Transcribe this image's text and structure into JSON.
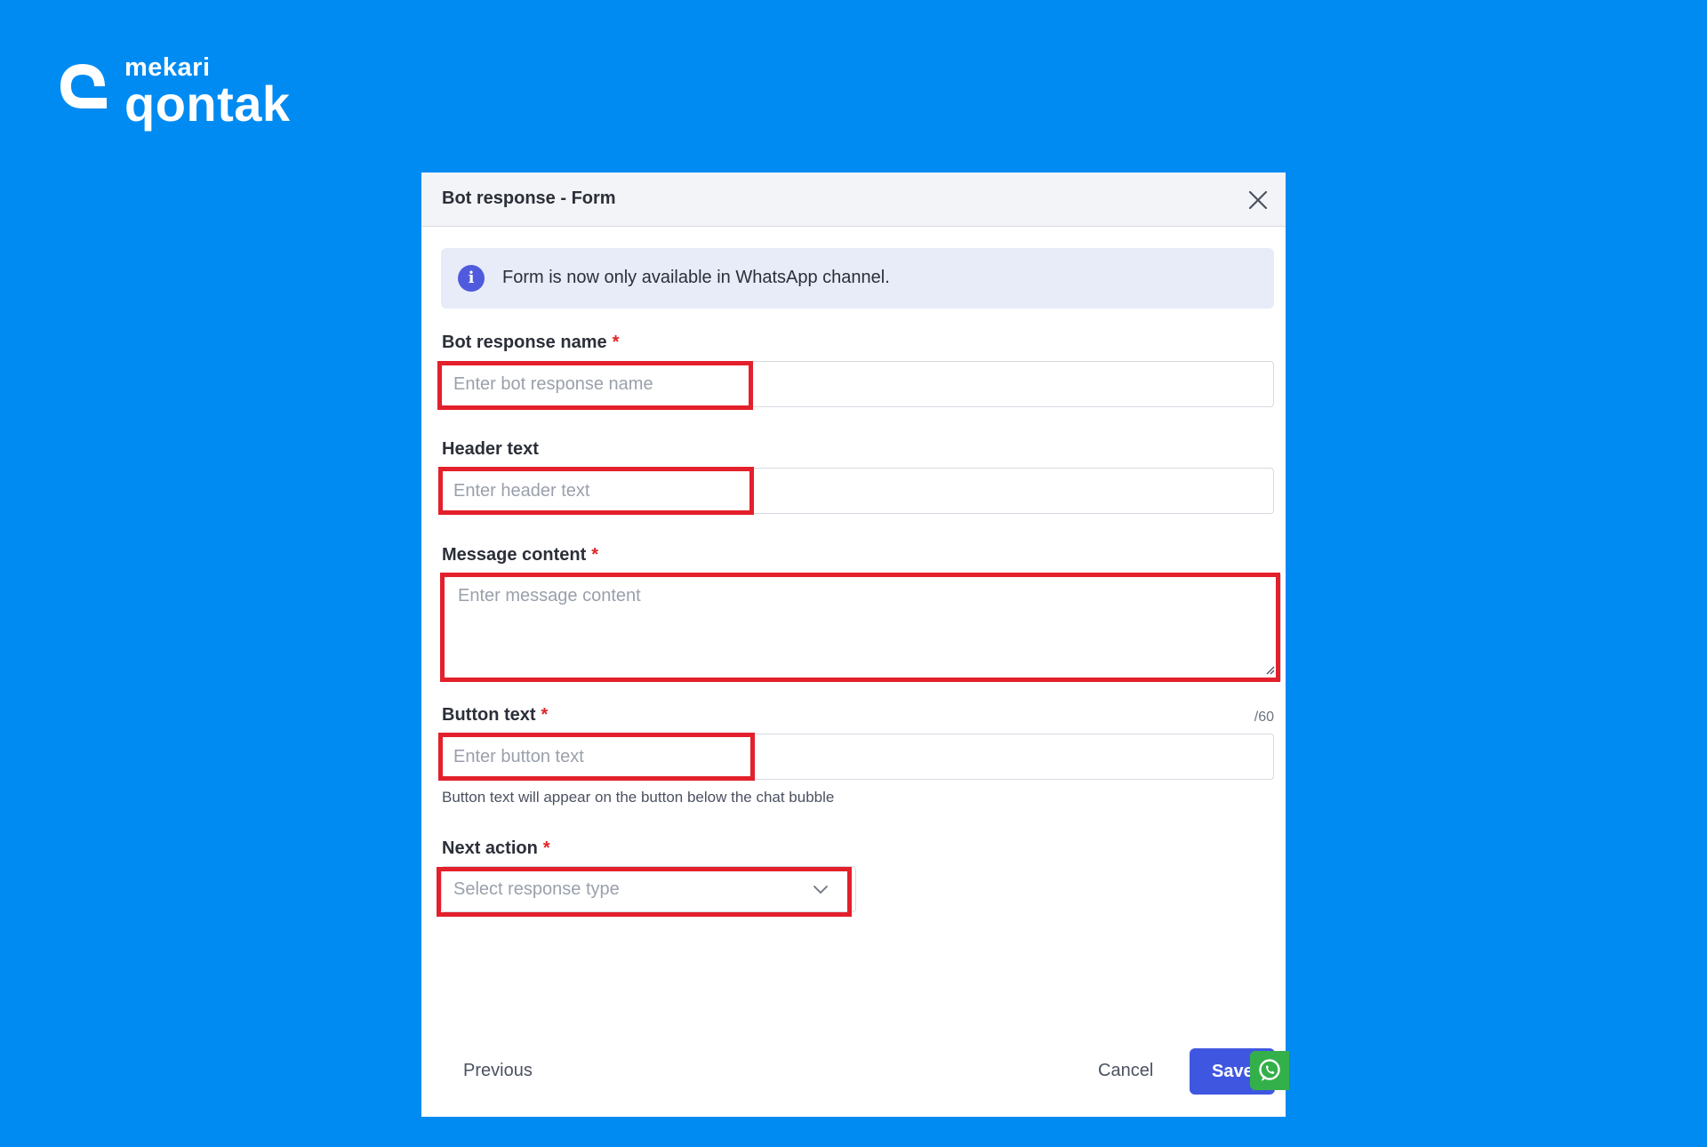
{
  "logo": {
    "small_text": "mekari",
    "big_text": "qontak"
  },
  "dialog": {
    "title": "Bot response - Form",
    "info_text": "Form is now only available in WhatsApp channel.",
    "fields": {
      "bot_response_name": {
        "label": "Bot response name",
        "required": "*",
        "placeholder": "Enter bot response name",
        "value": ""
      },
      "header_text": {
        "label": "Header text",
        "placeholder": "Enter header text",
        "value": ""
      },
      "message_content": {
        "label": "Message content",
        "required": "*",
        "placeholder": "Enter message content",
        "value": ""
      },
      "button_text": {
        "label": "Button text",
        "required": "*",
        "placeholder": "Enter button text",
        "value": "",
        "counter": "/60",
        "helper": "Button text will appear on the button below the chat bubble"
      },
      "next_action": {
        "label": "Next action",
        "required": "*",
        "placeholder": "Select response type"
      }
    },
    "footer": {
      "previous_label": "Previous",
      "cancel_label": "Cancel",
      "save_label": "Save"
    }
  },
  "colors": {
    "background": "#008bf2",
    "primary": "#3f57e0",
    "highlight": "#e3202b",
    "whatsapp": "#34b04a",
    "required": "#e02424"
  }
}
